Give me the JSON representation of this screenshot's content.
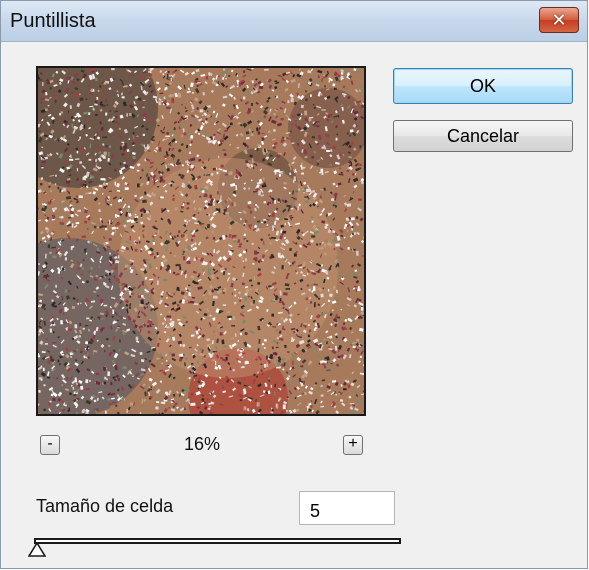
{
  "window": {
    "title": "Puntillista",
    "close_label": "✕"
  },
  "buttons": {
    "ok_label": "OK",
    "cancel_label": "Cancelar"
  },
  "zoom": {
    "minus_label": "-",
    "plus_label": "+",
    "level": "16%"
  },
  "cell_size": {
    "label": "Tamaño de celda",
    "value": "5",
    "slider_fraction": 0.0
  },
  "colors": {
    "titlebar": "#c9d9ec",
    "close_button": "#c94a2c",
    "ok_accent": "#3c7fb1",
    "dialog_background": "#f0f0f0"
  }
}
